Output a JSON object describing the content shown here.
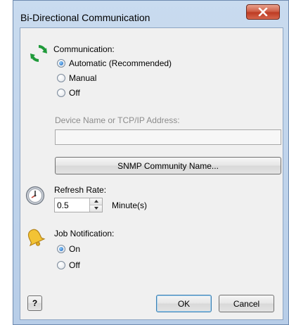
{
  "window": {
    "title": "Bi-Directional Communication",
    "close_icon": "close-icon"
  },
  "communication": {
    "label": "Communication:",
    "icon": "refresh-icon",
    "options": [
      {
        "label": "Automatic (Recommended)",
        "checked": true
      },
      {
        "label": "Manual",
        "checked": false
      },
      {
        "label": "Off",
        "checked": false
      }
    ],
    "device_label": "Device Name or TCP/IP Address:",
    "device_value": "",
    "snmp_button": "SNMP Community Name..."
  },
  "refresh": {
    "label": "Refresh Rate:",
    "icon": "clock-icon",
    "value": "0.5",
    "unit": "Minute(s)"
  },
  "job_notification": {
    "label": "Job Notification:",
    "icon": "bell-icon",
    "options": [
      {
        "label": "On",
        "checked": true
      },
      {
        "label": "Off",
        "checked": false
      }
    ]
  },
  "footer": {
    "help_label": "?",
    "ok_label": "OK",
    "cancel_label": "Cancel"
  },
  "colors": {
    "accent": "#3c7fb1",
    "close_button": "#c9452c",
    "client_background": "#f0f0f0"
  }
}
